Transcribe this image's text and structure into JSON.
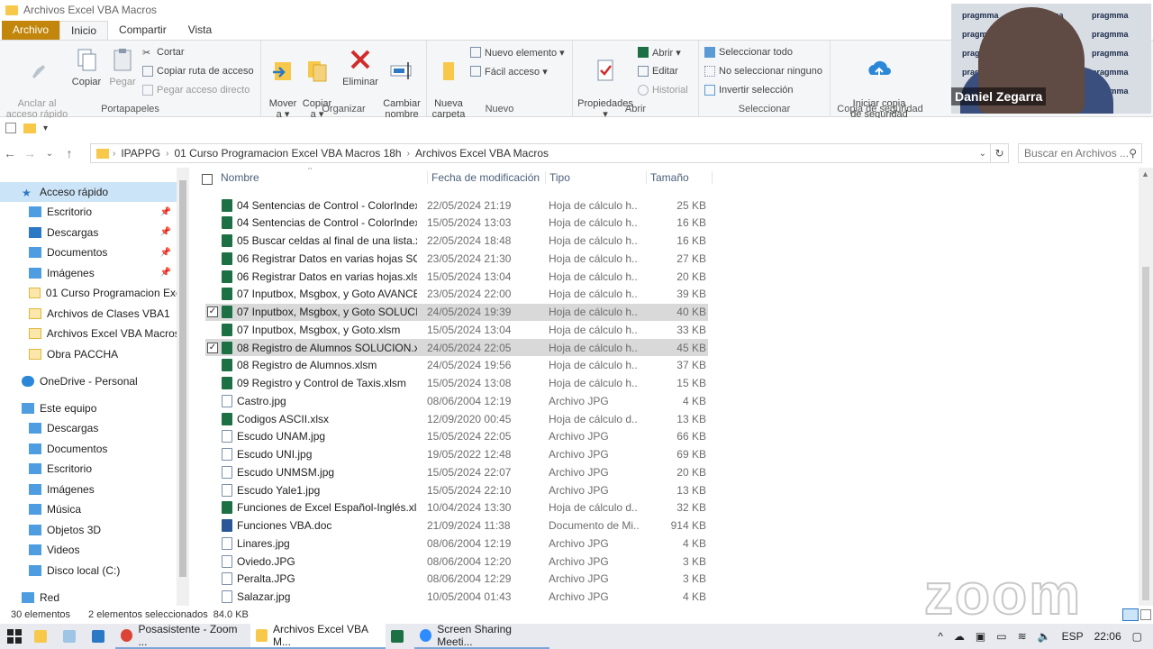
{
  "window": {
    "title": "Archivos Excel VBA Macros"
  },
  "tabs": [
    {
      "label": "Archivo"
    },
    {
      "label": "Inicio"
    },
    {
      "label": "Compartir"
    },
    {
      "label": "Vista"
    }
  ],
  "ribbon": {
    "clipboard": {
      "label": "Portapapeles",
      "pin": "Anclar al\nacceso rápido",
      "copy": "Copiar",
      "paste": "Pegar",
      "cut": "Cortar",
      "copy_path": "Copiar ruta de acceso",
      "paste_shortcut": "Pegar acceso directo"
    },
    "organize": {
      "label": "Organizar",
      "move_to": "Mover\na ▾",
      "copy_to": "Copiar\na ▾",
      "delete": "Eliminar",
      "rename": "Cambiar\nnombre"
    },
    "new": {
      "label": "Nuevo",
      "new_folder": "Nueva\ncarpeta",
      "new_item": "Nuevo elemento ▾",
      "easy_access": "Fácil acceso ▾"
    },
    "open": {
      "label": "Abrir",
      "properties": "Propiedades\n▾",
      "open": "Abrir ▾",
      "edit": "Editar",
      "history": "Historial"
    },
    "select": {
      "label": "Seleccionar",
      "select_all": "Seleccionar todo",
      "select_none": "No seleccionar ninguno",
      "invert": "Invertir selección"
    },
    "backup": {
      "label": "Copia de seguridad",
      "start": "Iniciar copia\nde seguridad"
    }
  },
  "address": {
    "crumbs": [
      "IPAPPG",
      "01 Curso Programacion Excel VBA Macros 18h",
      "Archivos Excel VBA Macros"
    ],
    "search_placeholder": "Buscar en Archivos ..."
  },
  "sidebar": {
    "quick_access": "Acceso rápido",
    "quick_items": [
      "Escritorio",
      "Descargas",
      "Documentos",
      "Imágenes",
      "01 Curso Programacion Excel",
      "Archivos de Clases VBA1",
      "Archivos Excel VBA Macros",
      "Obra PACCHA"
    ],
    "onedrive": "OneDrive - Personal",
    "this_pc": "Este equipo",
    "pc_items": [
      "Descargas",
      "Documentos",
      "Escritorio",
      "Imágenes",
      "Música",
      "Objetos 3D",
      "Videos",
      "Disco local (C:)"
    ],
    "network": "Red"
  },
  "columns": {
    "name": "Nombre",
    "date": "Fecha de modificación",
    "type": "Tipo",
    "size": "Tamaño"
  },
  "files": [
    {
      "name": "04 Sentencias de Control - ColorIndex ...",
      "date": "22/05/2024 21:19",
      "type": "Hoja de cálculo h...",
      "size": "25 KB",
      "icon": "excel-icon",
      "selected": false
    },
    {
      "name": "04 Sentencias de Control - ColorIndex....",
      "date": "15/05/2024 13:03",
      "type": "Hoja de cálculo h...",
      "size": "16 KB",
      "icon": "excel-icon",
      "selected": false
    },
    {
      "name": "05 Buscar celdas al final de una lista.xl...",
      "date": "22/05/2024 18:48",
      "type": "Hoja de cálculo h...",
      "size": "16 KB",
      "icon": "excel-icon",
      "selected": false
    },
    {
      "name": "06 Registrar Datos en varias hojas SOL...",
      "date": "23/05/2024 21:30",
      "type": "Hoja de cálculo h...",
      "size": "27 KB",
      "icon": "excel-icon",
      "selected": false
    },
    {
      "name": "06 Registrar Datos en varias hojas.xlsm",
      "date": "15/05/2024 13:04",
      "type": "Hoja de cálculo h...",
      "size": "20 KB",
      "icon": "excel-icon",
      "selected": false
    },
    {
      "name": "07 Inputbox, Msgbox, y Goto AVANCE...",
      "date": "23/05/2024 22:00",
      "type": "Hoja de cálculo h...",
      "size": "39 KB",
      "icon": "excel-icon",
      "selected": false
    },
    {
      "name": "07 Inputbox, Msgbox, y Goto SOLUCI...",
      "date": "24/05/2024 19:39",
      "type": "Hoja de cálculo h...",
      "size": "40 KB",
      "icon": "excel-icon",
      "selected": true
    },
    {
      "name": "07 Inputbox, Msgbox, y Goto.xlsm",
      "date": "15/05/2024 13:04",
      "type": "Hoja de cálculo h...",
      "size": "33 KB",
      "icon": "excel-icon",
      "selected": false
    },
    {
      "name": "08 Registro de Alumnos SOLUCION.xl...",
      "date": "24/05/2024 22:05",
      "type": "Hoja de cálculo h...",
      "size": "45 KB",
      "icon": "excel-icon",
      "selected": true
    },
    {
      "name": "08 Registro de Alumnos.xlsm",
      "date": "24/05/2024 19:56",
      "type": "Hoja de cálculo h...",
      "size": "37 KB",
      "icon": "excel-icon",
      "selected": false
    },
    {
      "name": "09 Registro y Control de Taxis.xlsm",
      "date": "15/05/2024 13:08",
      "type": "Hoja de cálculo h...",
      "size": "15 KB",
      "icon": "excel-icon",
      "selected": false
    },
    {
      "name": "Castro.jpg",
      "date": "08/06/2004 12:19",
      "type": "Archivo JPG",
      "size": "4 KB",
      "icon": "image-icon",
      "selected": false
    },
    {
      "name": "Codigos ASCII.xlsx",
      "date": "12/09/2020 00:45",
      "type": "Hoja de cálculo d...",
      "size": "13 KB",
      "icon": "excel-icon",
      "selected": false
    },
    {
      "name": "Escudo UNAM.jpg",
      "date": "15/05/2024 22:05",
      "type": "Archivo JPG",
      "size": "66 KB",
      "icon": "image-icon",
      "selected": false
    },
    {
      "name": "Escudo UNI.jpg",
      "date": "19/05/2022 12:48",
      "type": "Archivo JPG",
      "size": "69 KB",
      "icon": "image-icon",
      "selected": false
    },
    {
      "name": "Escudo UNMSM.jpg",
      "date": "15/05/2024 22:07",
      "type": "Archivo JPG",
      "size": "20 KB",
      "icon": "image-icon",
      "selected": false
    },
    {
      "name": "Escudo Yale1.jpg",
      "date": "15/05/2024 22:10",
      "type": "Archivo JPG",
      "size": "13 KB",
      "icon": "image-icon",
      "selected": false
    },
    {
      "name": "Funciones de Excel Español-Inglés.xlsx",
      "date": "10/04/2024 13:30",
      "type": "Hoja de cálculo d...",
      "size": "32 KB",
      "icon": "excel-icon",
      "selected": false
    },
    {
      "name": "Funciones VBA.doc",
      "date": "21/09/2024 11:38",
      "type": "Documento de Mi...",
      "size": "914 KB",
      "icon": "word-icon",
      "selected": false
    },
    {
      "name": "Linares.jpg",
      "date": "08/06/2004 12:19",
      "type": "Archivo JPG",
      "size": "4 KB",
      "icon": "image-icon",
      "selected": false
    },
    {
      "name": "Oviedo.JPG",
      "date": "08/06/2004 12:20",
      "type": "Archivo JPG",
      "size": "3 KB",
      "icon": "image-icon",
      "selected": false
    },
    {
      "name": "Peralta.JPG",
      "date": "08/06/2004 12:29",
      "type": "Archivo JPG",
      "size": "3 KB",
      "icon": "image-icon",
      "selected": false
    },
    {
      "name": "Salazar.jpg",
      "date": "10/05/2004 01:43",
      "type": "Archivo JPG",
      "size": "4 KB",
      "icon": "image-icon",
      "selected": false
    }
  ],
  "status": {
    "count": "30 elementos",
    "selection": "2 elementos seleccionados",
    "size": "84.0 KB"
  },
  "taskbar": {
    "apps": [
      "Posasistente - Zoom ...",
      "Archivos Excel VBA M...",
      "Screen Sharing Meeti..."
    ],
    "lang": "ESP",
    "time": "22:06"
  },
  "video": {
    "speaker": "Daniel Zegarra",
    "slide_word": "pragmma"
  },
  "watermark": "zoom"
}
